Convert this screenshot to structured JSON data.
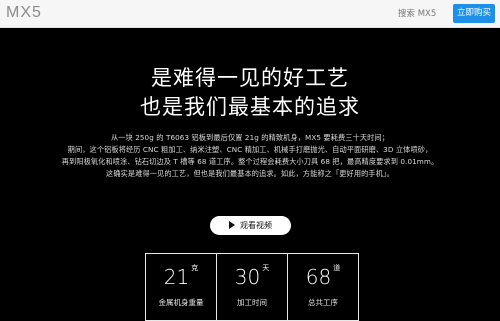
{
  "header": {
    "logo": "MX5",
    "search_label": "搜索 MX5",
    "buy_button": "立即购买"
  },
  "hero": {
    "headline_1": "是难得一见的好工艺",
    "headline_2": "也是我们最基本的追求",
    "paragraph": [
      "从一块 250g 的 T6063 铝板到最后仅置 21g 的精致机身，MX5 要耗费三十天时间；",
      "期间，这个铝板将经历 CNC 粗加工、纳米注塑、CNC 精加工、机械手打磨抛光、自动平面研磨、3D 立体喷砂，",
      "再到阳极氧化和喷涂、钻石切边及 T 槽等 68 道工序。整个过程会耗费大小刀具 68 把，最高精度要求到 0.01mm。",
      "这确实是难得一见的工艺，但也是我们最基本的追求。如此，方能称之「更好用的手机」。"
    ],
    "video_button": "观看视频"
  },
  "stats": [
    {
      "value": "21",
      "unit": "克",
      "label": "金属机身重量"
    },
    {
      "value": "30",
      "unit": "天",
      "label": "加工时间"
    },
    {
      "value": "68",
      "unit": "道",
      "label": "总共工序"
    }
  ],
  "colors": {
    "accent": "#1e90e8",
    "background": "#000000",
    "topbar": "#f6f6f6"
  }
}
